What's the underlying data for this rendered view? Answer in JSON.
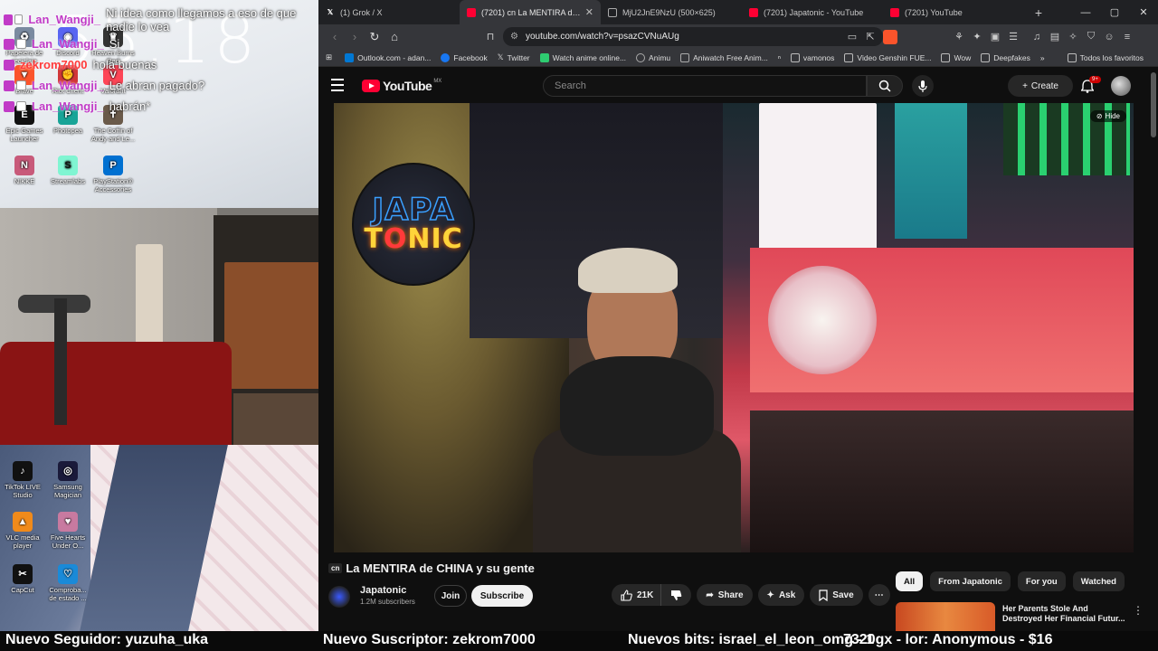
{
  "overlay": {
    "clock": "55.18",
    "chat": [
      {
        "user": "Lan_Wangji_",
        "message": "Ni idea como llegamos a eso de que nadie lo vea"
      },
      {
        "user": "Lan_Wangji_",
        "message": "Si"
      },
      {
        "user": "zekrom7000",
        "message": "hola buenas"
      },
      {
        "user": "Lan_Wangji_",
        "message": "Le abran pagado?"
      },
      {
        "user": "Lan_Wangji_",
        "message": "habrán*"
      }
    ],
    "desktop_icons_top": [
      "Papelera de reciclaje",
      "Discord",
      "Heaven Burns Red",
      "Brave",
      "Riot Client",
      "Valorant",
      "Epic Games Launcher",
      "Photopea",
      "The Coffin of Andy and Le...",
      "NIKKE",
      "Streamlabs",
      "PlayStation® Accessories"
    ],
    "desktop_icons_bottom": [
      "TikTok LIVE Studio",
      "Samsung Magician",
      "VLC media player",
      "Five Hearts Under O...",
      "CapCut",
      "Comproba... de estado ..."
    ]
  },
  "browser": {
    "tabs": [
      {
        "title": "(1) Grok / X",
        "icon": "x-icon",
        "active": false
      },
      {
        "title": "(7201) cn La MENTIRA de CHI",
        "icon": "youtube-icon",
        "active": true
      },
      {
        "title": "MjU2JnE9NzU (500×625)",
        "icon": "globe-icon",
        "active": false
      },
      {
        "title": "(7201) Japatonic - YouTube",
        "icon": "youtube-icon",
        "active": false
      },
      {
        "title": "(7201) YouTube",
        "icon": "youtube-icon",
        "active": false
      }
    ],
    "url": "youtube.com/watch?v=psazCVNuAUg",
    "bookmarks": [
      {
        "label": "Outlook.com - adan...",
        "color": "#0078d4"
      },
      {
        "label": "Facebook",
        "color": "#1877f2"
      },
      {
        "label": "Twitter",
        "color": "#ffffff"
      },
      {
        "label": "Watch anime online...",
        "color": "#2ecc71"
      },
      {
        "label": "Animu",
        "color": "#888888"
      },
      {
        "label": "Aniwatch Free Anim...",
        "color": "#888888"
      },
      {
        "label": "vamonos",
        "color": "folder"
      },
      {
        "label": "Video Genshin FUE...",
        "color": "folder"
      },
      {
        "label": "Wow",
        "color": "folder"
      },
      {
        "label": "Deepfakes",
        "color": "folder"
      }
    ],
    "bookmarks_more": "»",
    "all_bookmarks": "Todos los favoritos"
  },
  "youtube": {
    "logo_text": "YouTube",
    "region": "MX",
    "search_placeholder": "Search",
    "create_label": "Create",
    "notif_count": "9+",
    "video": {
      "logo_top": "JAPA",
      "logo_bottom_1": "T",
      "logo_bottom_o": "O",
      "logo_bottom_2": "NIC",
      "hide_label": "Hide"
    },
    "title_prefix": "cn",
    "title": "La MENTIRA de CHINA y su gente",
    "channel": {
      "name": "Japatonic",
      "subs": "1.2M subscribers"
    },
    "join_label": "Join",
    "subscribe_label": "Subscribe",
    "actions": {
      "likes": "21K",
      "share": "Share",
      "ask": "Ask",
      "save": "Save"
    },
    "chips": [
      "All",
      "From Japatonic",
      "For you",
      "Watched"
    ],
    "recommendation_title": "Her Parents Stole And Destroyed Her Financial Futur..."
  },
  "ticker": {
    "follower": "Nuevo Seguidor: yuzuha_uka",
    "subscriber": "Nuevo Suscriptor: zekrom7000",
    "bits": "Nuevos bits: israel_el_leon_omg - 1",
    "tip": "7320gx - lor: Anonymous - $16"
  }
}
